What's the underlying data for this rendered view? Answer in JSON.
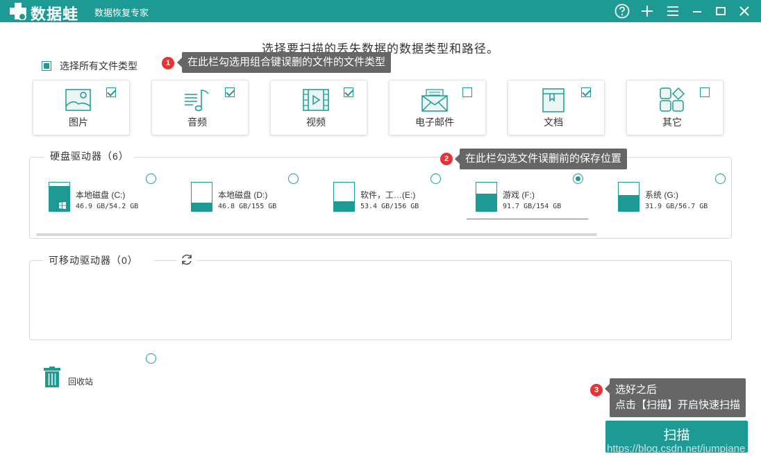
{
  "titlebar": {
    "logo_text": "数据蛙",
    "app_title": "数据恢复专家",
    "buttons": [
      "help-icon",
      "plus-icon",
      "menu-icon",
      "minimize-icon",
      "maximize-icon",
      "close-icon"
    ],
    "bg_color": "#1c9a93"
  },
  "instruction": "选择要扫描的丢失数据的数据类型和路径。",
  "select_all": {
    "label": "选择所有文件类型",
    "state": "partial"
  },
  "file_types": [
    {
      "label": "图片",
      "checked": true,
      "icon": "image-icon"
    },
    {
      "label": "音频",
      "checked": true,
      "icon": "audio-icon"
    },
    {
      "label": "视频",
      "checked": true,
      "icon": "video-icon"
    },
    {
      "label": "电子邮件",
      "checked": false,
      "icon": "email-icon"
    },
    {
      "label": "文档",
      "checked": true,
      "icon": "document-icon"
    },
    {
      "label": "其它",
      "checked": false,
      "icon": "other-icon"
    }
  ],
  "hard_drives": {
    "title": "硬盘驱动器（6）",
    "items": [
      {
        "name": "本地磁盘 (C:)",
        "size": "46.9 GB/54.2 GB",
        "used_fraction": 0.87,
        "selected": false
      },
      {
        "name": "本地磁盘 (D:)",
        "size": "46.8 GB/155 GB",
        "used_fraction": 0.3,
        "selected": false
      },
      {
        "name": "软件，工…(E:)",
        "size": "53.4 GB/156 GB",
        "used_fraction": 0.34,
        "selected": false
      },
      {
        "name": "游戏 (F:)",
        "size": "91.7 GB/154 GB",
        "used_fraction": 0.6,
        "selected": true
      },
      {
        "name": "系统 (G:)",
        "size": "31.9 GB/56.7 GB",
        "used_fraction": 0.56,
        "selected": false
      }
    ]
  },
  "removable_drives": {
    "title": "可移动驱动器（0）"
  },
  "recycle_bin": {
    "label": "回收站",
    "selected": false
  },
  "tooltips": [
    {
      "badge": "1",
      "text": "在此栏勾选用组合键误删的文件的文件类型"
    },
    {
      "badge": "2",
      "text": "在此栏勾选文件误删前的保存位置"
    },
    {
      "badge": "3",
      "line1": "选好之后",
      "line2": "点击【扫描】开启快速扫描"
    }
  ],
  "scan_button": {
    "label": "扫描"
  },
  "watermark": "https://blog.csdn.net/jumpjane",
  "colors": {
    "accent": "#1c9a93",
    "tooltip_bg": "#666666",
    "badge_red": "#e63333"
  }
}
